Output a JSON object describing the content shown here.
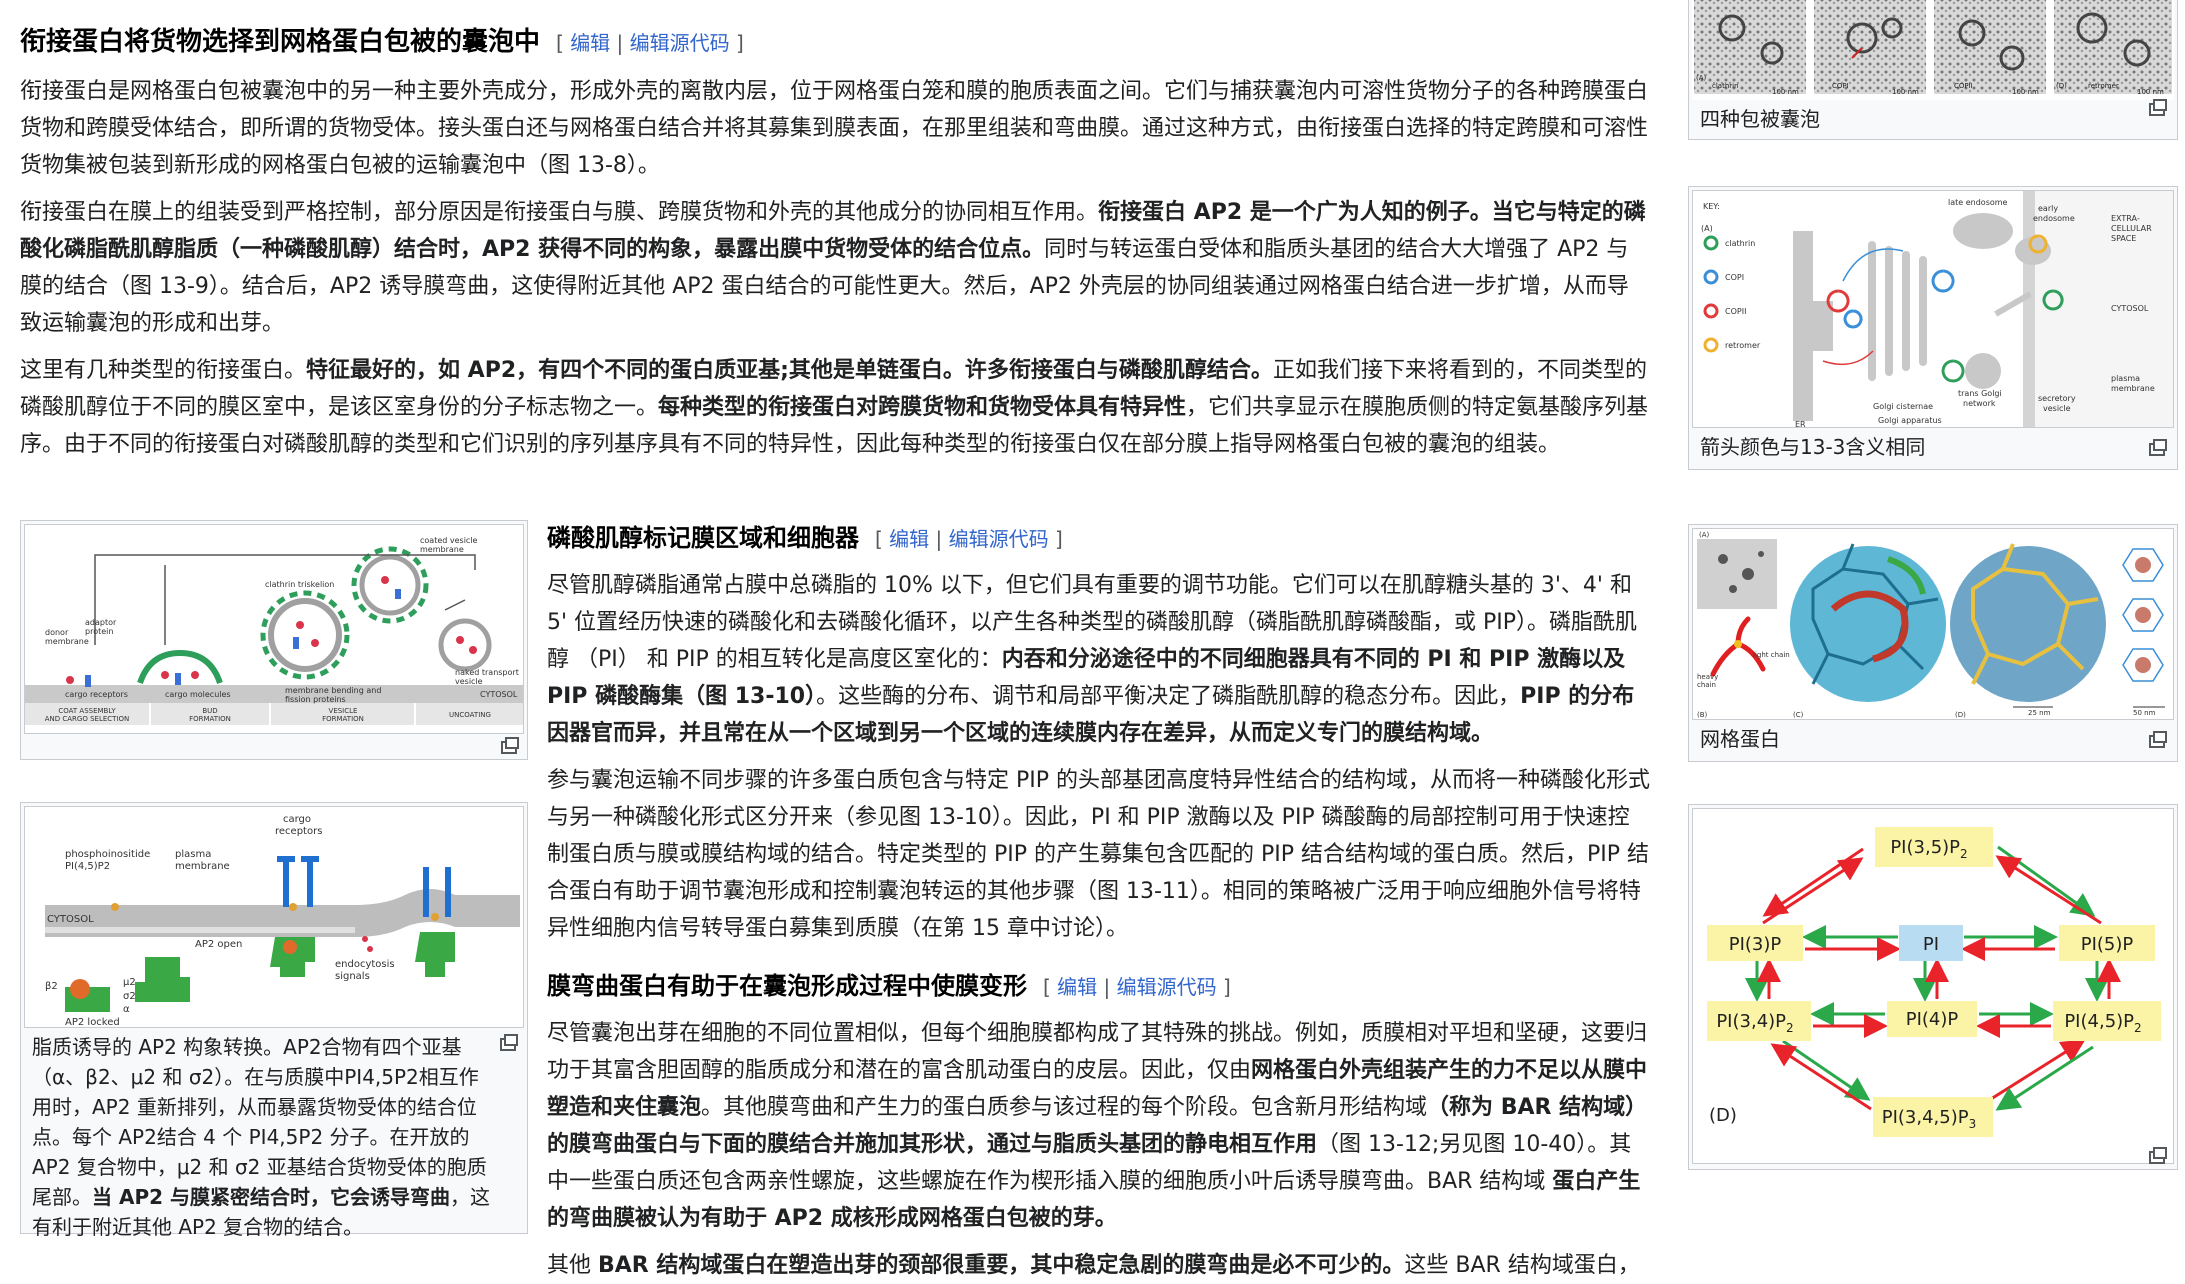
{
  "edit": {
    "edit": "编辑",
    "source": "编辑源代码",
    "open": "[",
    "close": "]",
    "sep": "|"
  },
  "section1": {
    "heading": "衔接蛋白将货物选择到网格蛋白包被的囊泡中",
    "p1": "衔接蛋白是网格蛋白包被囊泡中的另一种主要外壳成分，形成外壳的离散内层，位于网格蛋白笼和膜的胞质表面之间。它们与捕获囊泡内可溶性货物分子的各种跨膜蛋白货物和跨膜受体结合，即所谓的货物受体。接头蛋白还与网格蛋白结合并将其募集到膜表面，在那里组装和弯曲膜。通过这种方式，由衔接蛋白选择的特定跨膜和可溶性货物集被包装到新形成的网格蛋白包被的运输囊泡中（图 13-8）。",
    "p2_a": "衔接蛋白在膜上的组装受到严格控制，部分原因是衔接蛋白与膜、跨膜货物和外壳的其他成分的协同相互作用。",
    "p2_b": "衔接蛋白 AP2 是一个广为人知的例子。当它与特定的磷酸化磷脂酰肌醇脂质（一种磷酸肌醇）结合时，AP2 获得不同的构象，暴露出膜中货物受体的结合位点。",
    "p2_c": "同时与转运蛋白受体和脂质头基团的结合大大增强了 AP2 与膜的结合（图 13-9）。结合后，AP2 诱导膜弯曲，这使得附近其他 AP2 蛋白结合的可能性更大。然后，AP2 外壳层的协同组装通过网格蛋白结合进一步扩增，从而导致运输囊泡的形成和出芽。",
    "p3_a": "这里有几种类型的衔接蛋白。",
    "p3_b": "特征最好的，如 AP2，有四个不同的蛋白质亚基;其他是单链蛋白。许多衔接蛋白与磷酸肌醇结合。",
    "p3_c": "正如我们接下来将看到的，不同类型的磷酸肌醇位于不同的膜区室中，是该区室身份的分子标志物之一。",
    "p3_d": "每种类型的衔接蛋白对跨膜货物和货物受体具有特异性",
    "p3_e": "，它们共享显示在膜胞质侧的特定氨基酸序列基序。由于不同的衔接蛋白对磷酸肌醇的类型和它们识别的序列基序具有不同的特异性，因此每种类型的衔接蛋白仅在部分膜上指导网格蛋白包被的囊泡的组装。"
  },
  "section2": {
    "heading": "磷酸肌醇标记膜区域和细胞器",
    "p1_a": "尽管肌醇磷脂通常占膜中总磷脂的 10% 以下，但它们具有重要的调节功能。它们可以在肌醇糖头基的 3'、4' 和 5' 位置经历快速的磷酸化和去磷酸化循环，以产生各种类型的磷酸肌醇（磷脂酰肌醇磷酸酯，或 PIP）。磷脂酰肌醇 （PI） 和 PIP 的相互转化是高度区室化的：",
    "p1_b": "内吞和分泌途径中的不同细胞器具有不同的 PI 和 PIP 激酶以及 PIP 磷酸酶集（图 13-10）",
    "p1_c": "。这些酶的分布、调节和局部平衡决定了磷脂酰肌醇的稳态分布。因此，",
    "p1_d": "PIP 的分布因器官而异，并且常在从一个区域到另一个区域的连续膜内存在差异，从而定义专门的膜结构域。",
    "p2": "参与囊泡运输不同步骤的许多蛋白质包含与特定 PIP 的头部基团高度特异性结合的结构域，从而将一种磷酸化形式与另一种磷酸化形式区分开来（参见图 13-10）。因此，PI 和 PIP 激酶以及 PIP 磷酸酶的局部控制可用于快速控制蛋白质与膜或膜结构域的结合。特定类型的 PIP 的产生募集包含匹配的 PIP 结合结构域的蛋白质。然后，PIP 结合蛋白有助于调节囊泡形成和控制囊泡转运的其他步骤（图 13-11）。相同的策略被广泛用于响应细胞外信号将特异性细胞内信号转导蛋白募集到质膜（在第 15 章中讨论）。"
  },
  "section3": {
    "heading": "膜弯曲蛋白有助于在囊泡形成过程中使膜变形",
    "p1_a": "尽管囊泡出芽在细胞的不同位置相似，但每个细胞膜都构成了其特殊的挑战。例如，质膜相对平坦和坚硬，这要归功于其富含胆固醇的脂质成分和潜在的富含肌动蛋白的皮层。因此，仅由",
    "p1_b": "网格蛋白外壳组装产生的力不足以从膜中塑造和夹住囊泡",
    "p1_c": "。其他膜弯曲和产生力的蛋白质参与该过程的每个阶段。包含新月形结构域",
    "p1_d": "（称为 BAR 结构域）的膜弯曲蛋白与下面的膜结合并施加其形状，通过与脂质头基团的静电相互作用",
    "p1_e": "（图 13-12;另见图 10-40）。其中一些蛋白质还包含两亲性螺旋，这些螺旋在作为楔形插入膜的细胞质小叶后诱导膜弯曲。BAR 结构域 ",
    "p1_f": "蛋白产生的弯曲膜被认为有助于 AP2 成核形成网格蛋白包被的芽。",
    "p2_a": "其他 ",
    "p2_b": "BAR 结构域蛋白在塑造出芽的颈部很重要，其中稳定急剧的膜弯曲是必不可少的。",
    "p2_c": "这些 BAR 结构域蛋白，"
  },
  "captions": {
    "top_right": "四种包被囊泡",
    "key_fig": "箭头颜色与13-3含义相同",
    "clathrin_fig": "网格蛋白",
    "ap2_a": "脂质诱导的 AP2 构象转换。AP2合物有四个亚基（α、β2、μ2 和 σ2）。在与质膜中PI4,5P2相互作用时，AP2 重新排列，从而暴露货物受体的结合位点。每个 AP2结合 4 个 PI4,5P2 分子。在开放的 AP2 复合物中，μ2 和 σ2 亚基结合货物受体的胞质尾部。",
    "ap2_b": "当 AP2 与膜紧密结合时，它会诱导弯曲",
    "ap2_c": "，这有利于附近其他 AP2 复合物的结合。"
  },
  "fig_top_right": {
    "labels": [
      "clathrin",
      "COPI",
      "COPII",
      "COPII",
      "(D)",
      "retromer"
    ],
    "scale": [
      "100 nm",
      "100 nm",
      "100 nm",
      "100 nm"
    ]
  },
  "fig_key": {
    "key_title": "KEY:",
    "key_items": [
      "clathrin",
      "COPI",
      "COPII",
      "retromer"
    ],
    "labels": {
      "late_endosome": "late endosome",
      "early_endosome_1": "early",
      "early_endosome_2": "endosome",
      "extra_1": "EXTRA-",
      "extra_2": "CELLULAR",
      "extra_3": "SPACE",
      "cytosol": "CYTOSOL",
      "plasma_1": "plasma",
      "plasma_2": "membrane",
      "er": "ER",
      "golgi_cisternae": "Golgi cisternae",
      "trans_golgi_1": "trans Golgi",
      "trans_golgi_2": "network",
      "golgi_apparatus": "Golgi apparatus",
      "secretory_1": "secretory",
      "secretory_2": "vesicle",
      "panel": "(A)"
    },
    "colors": {
      "clathrin": "#2e9e5b",
      "copi": "#3b8fd8",
      "copii": "#e03a3a",
      "retromer": "#f0b030",
      "membrane": "#c8c8c8"
    }
  },
  "fig_clathrin": {
    "labels": {
      "light_chain": "light chain",
      "heavy_chain_1": "heavy",
      "heavy_chain_2": "chain",
      "a": "(A)",
      "b": "(B)",
      "c": "(C)",
      "d": "(D)",
      "scale1": "25 nm",
      "scale2": "50 nm"
    }
  },
  "fig_coat": {
    "labels": {
      "donor_1": "donor",
      "donor_2": "membrane",
      "adaptor_1": "adaptor",
      "adaptor_2": "protein",
      "clathrin_triskelion": "clathrin triskelion",
      "coated_1": "coated vesicle",
      "coated_2": "membrane",
      "cargo_receptors": "cargo receptors",
      "cargo_molecules": "cargo molecules",
      "bending_1": "membrane bending and",
      "bending_2": "fission proteins",
      "naked_1": "naked transport",
      "naked_2": "vesicle",
      "cytosol": "CYTOSOL",
      "stage1_1": "COAT ASSEMBLY",
      "stage1_2": "AND CARGO SELECTION",
      "stage2_1": "BUD",
      "stage2_2": "FORMATION",
      "stage3_1": "VESICLE",
      "stage3_2": "FORMATION",
      "stage4": "UNCOATING"
    }
  },
  "fig_ap2": {
    "labels": {
      "pip_1": "phosphoinositide",
      "pip_2": "PI(4,5)P2",
      "plasma_1": "plasma",
      "plasma_2": "membrane",
      "cargo_1": "cargo",
      "cargo_2": "receptors",
      "cytosol": "CYTOSOL",
      "endo_1": "endocytosis",
      "endo_2": "signals",
      "ap2_open": "AP2 open",
      "ap2_locked": "AP2 locked",
      "b2": "β2",
      "m2": "μ2",
      "s2": "σ2",
      "a": "α"
    }
  },
  "fig_pip": {
    "nodes": {
      "pi35p2": "PI(3,5)P",
      "pi3p": "PI(3)P",
      "pi": "PI",
      "pi5p": "PI(5)P",
      "pi34p2": "PI(3,4)P",
      "pi4p": "PI(4)P",
      "pi45p2": "PI(4,5)P",
      "pi345p3": "PI(3,4,5)P",
      "sub2": "2",
      "sub3": "3"
    },
    "panel": "(D)",
    "colors": {
      "node": "#fbf4a6",
      "pi_node": "#b8dcf2",
      "kinase": "#2aa84a",
      "phosphatase": "#e8232a"
    }
  }
}
